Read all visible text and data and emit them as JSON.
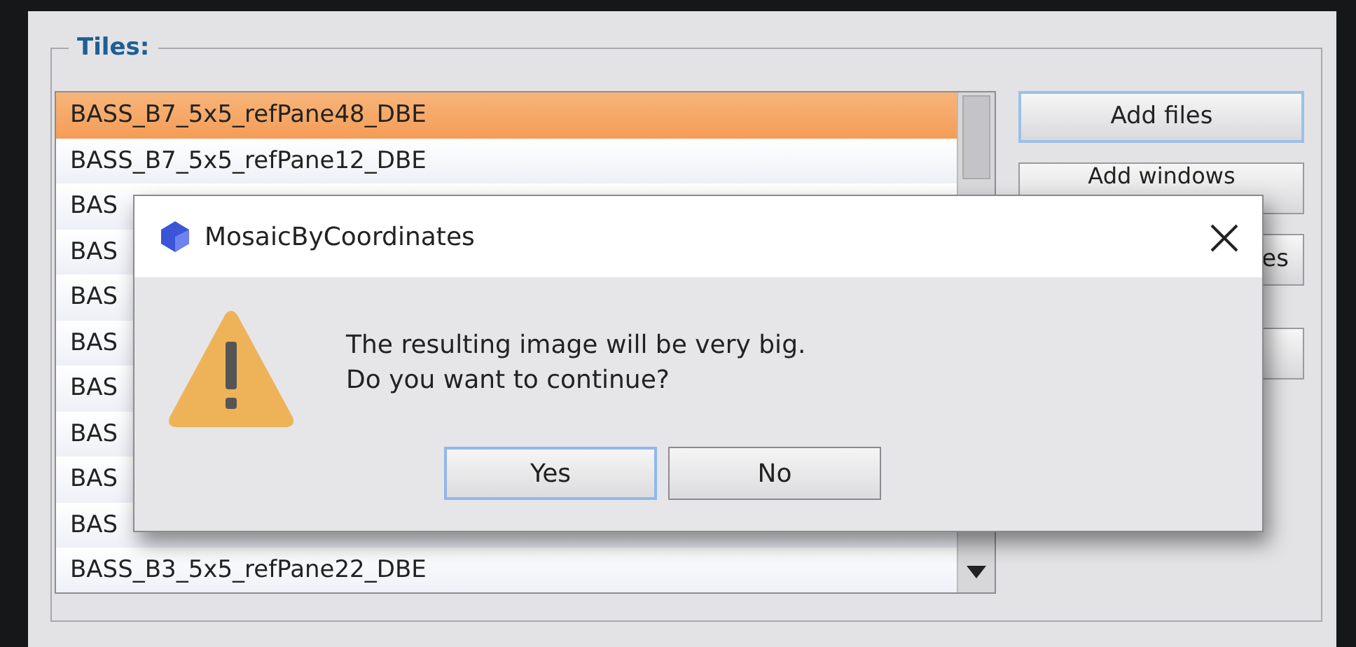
{
  "group": {
    "title": "Tiles:"
  },
  "files": [
    {
      "label": "BASS_B7_5x5_refPane48_DBE",
      "selected": true
    },
    {
      "label": "BASS_B7_5x5_refPane12_DBE",
      "selected": false
    },
    {
      "label": "BAS",
      "selected": false
    },
    {
      "label": "BAS",
      "selected": false
    },
    {
      "label": "BAS",
      "selected": false
    },
    {
      "label": "BAS",
      "selected": false
    },
    {
      "label": "BAS",
      "selected": false
    },
    {
      "label": "BAS",
      "selected": false
    },
    {
      "label": "BAS",
      "selected": false
    },
    {
      "label": "BAS",
      "selected": false
    },
    {
      "label": "BASS_B3_5x5_refPane22_DBE",
      "selected": false
    }
  ],
  "buttons": [
    {
      "label": "Add files",
      "focused": true
    },
    {
      "label": "Add windows",
      "focused": false
    },
    {
      "label": "es",
      "focused": false
    },
    {
      "focused": false
    }
  ],
  "dialog": {
    "title": "MosaicByCoordinates",
    "message": [
      "The resulting image will be very big.",
      "Do you want to continue?"
    ],
    "buttons": [
      {
        "label": "Yes",
        "focused": true
      },
      {
        "label": "No",
        "focused": false
      }
    ]
  }
}
